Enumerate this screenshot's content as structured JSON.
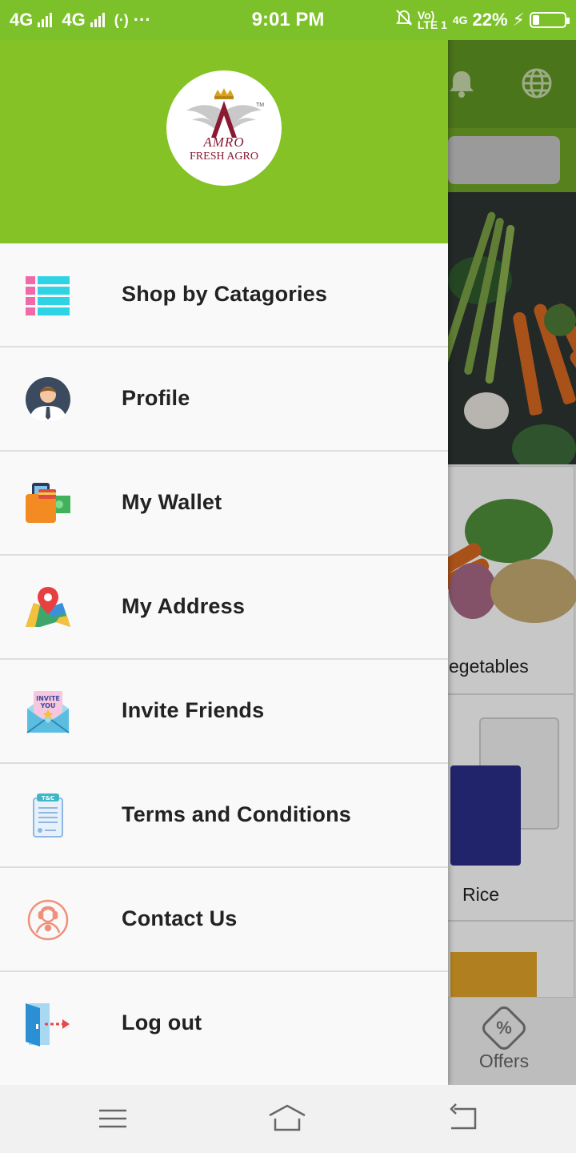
{
  "status_bar": {
    "network1": "4G",
    "network2": "4G",
    "time": "9:01 PM",
    "volte": "Vo) LTE 1",
    "network3": "4G",
    "battery": "22%",
    "battery_level": 0.22
  },
  "logo": {
    "name": "AMRO",
    "subtitle": "FRESH AGRO",
    "trademark": "TM"
  },
  "menu": {
    "items": [
      {
        "label": "Shop by Catagories",
        "icon": "categories-grid-icon"
      },
      {
        "label": "Profile",
        "icon": "profile-avatar-icon"
      },
      {
        "label": "My Wallet",
        "icon": "wallet-icon"
      },
      {
        "label": "My Address",
        "icon": "map-pin-icon"
      },
      {
        "label": "Invite Friends",
        "icon": "invite-envelope-icon"
      },
      {
        "label": "Terms and Conditions",
        "icon": "terms-document-icon"
      },
      {
        "label": "Contact Us",
        "icon": "contact-support-icon"
      },
      {
        "label": "Log out",
        "icon": "logout-door-icon"
      }
    ]
  },
  "background_app": {
    "category_vegetables": "egetables",
    "category_rice": "Rice",
    "tab_offers": "Offers",
    "offers_symbol": "%"
  },
  "colors": {
    "drawer_header": "#84c226",
    "status_bar": "#7cc12a",
    "menu_text": "#222222"
  }
}
